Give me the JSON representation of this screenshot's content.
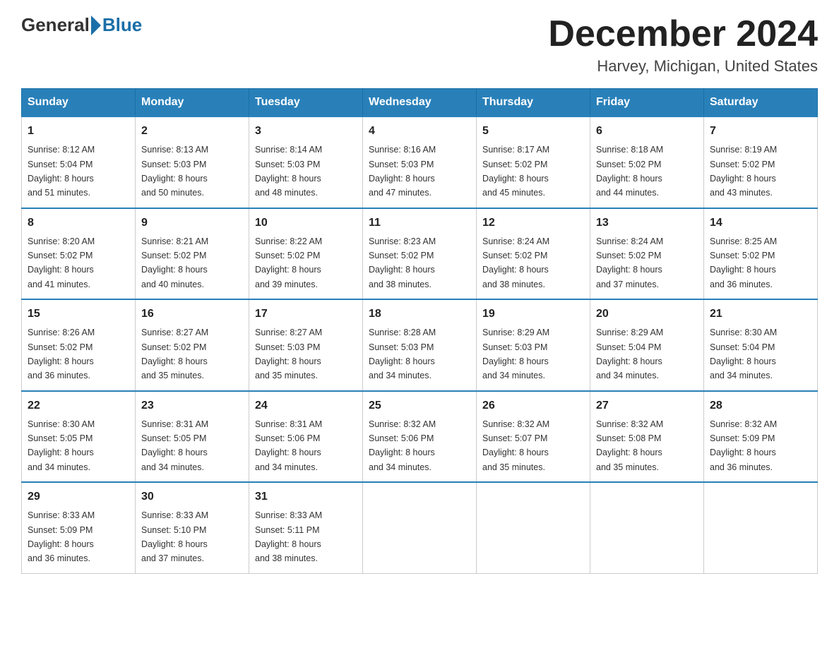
{
  "header": {
    "logo_general": "General",
    "logo_blue": "Blue",
    "title": "December 2024",
    "subtitle": "Harvey, Michigan, United States"
  },
  "days_of_week": [
    "Sunday",
    "Monday",
    "Tuesday",
    "Wednesday",
    "Thursday",
    "Friday",
    "Saturday"
  ],
  "weeks": [
    [
      {
        "day": "1",
        "sunrise": "8:12 AM",
        "sunset": "5:04 PM",
        "daylight": "8 hours and 51 minutes."
      },
      {
        "day": "2",
        "sunrise": "8:13 AM",
        "sunset": "5:03 PM",
        "daylight": "8 hours and 50 minutes."
      },
      {
        "day": "3",
        "sunrise": "8:14 AM",
        "sunset": "5:03 PM",
        "daylight": "8 hours and 48 minutes."
      },
      {
        "day": "4",
        "sunrise": "8:16 AM",
        "sunset": "5:03 PM",
        "daylight": "8 hours and 47 minutes."
      },
      {
        "day": "5",
        "sunrise": "8:17 AM",
        "sunset": "5:02 PM",
        "daylight": "8 hours and 45 minutes."
      },
      {
        "day": "6",
        "sunrise": "8:18 AM",
        "sunset": "5:02 PM",
        "daylight": "8 hours and 44 minutes."
      },
      {
        "day": "7",
        "sunrise": "8:19 AM",
        "sunset": "5:02 PM",
        "daylight": "8 hours and 43 minutes."
      }
    ],
    [
      {
        "day": "8",
        "sunrise": "8:20 AM",
        "sunset": "5:02 PM",
        "daylight": "8 hours and 41 minutes."
      },
      {
        "day": "9",
        "sunrise": "8:21 AM",
        "sunset": "5:02 PM",
        "daylight": "8 hours and 40 minutes."
      },
      {
        "day": "10",
        "sunrise": "8:22 AM",
        "sunset": "5:02 PM",
        "daylight": "8 hours and 39 minutes."
      },
      {
        "day": "11",
        "sunrise": "8:23 AM",
        "sunset": "5:02 PM",
        "daylight": "8 hours and 38 minutes."
      },
      {
        "day": "12",
        "sunrise": "8:24 AM",
        "sunset": "5:02 PM",
        "daylight": "8 hours and 38 minutes."
      },
      {
        "day": "13",
        "sunrise": "8:24 AM",
        "sunset": "5:02 PM",
        "daylight": "8 hours and 37 minutes."
      },
      {
        "day": "14",
        "sunrise": "8:25 AM",
        "sunset": "5:02 PM",
        "daylight": "8 hours and 36 minutes."
      }
    ],
    [
      {
        "day": "15",
        "sunrise": "8:26 AM",
        "sunset": "5:02 PM",
        "daylight": "8 hours and 36 minutes."
      },
      {
        "day": "16",
        "sunrise": "8:27 AM",
        "sunset": "5:02 PM",
        "daylight": "8 hours and 35 minutes."
      },
      {
        "day": "17",
        "sunrise": "8:27 AM",
        "sunset": "5:03 PM",
        "daylight": "8 hours and 35 minutes."
      },
      {
        "day": "18",
        "sunrise": "8:28 AM",
        "sunset": "5:03 PM",
        "daylight": "8 hours and 34 minutes."
      },
      {
        "day": "19",
        "sunrise": "8:29 AM",
        "sunset": "5:03 PM",
        "daylight": "8 hours and 34 minutes."
      },
      {
        "day": "20",
        "sunrise": "8:29 AM",
        "sunset": "5:04 PM",
        "daylight": "8 hours and 34 minutes."
      },
      {
        "day": "21",
        "sunrise": "8:30 AM",
        "sunset": "5:04 PM",
        "daylight": "8 hours and 34 minutes."
      }
    ],
    [
      {
        "day": "22",
        "sunrise": "8:30 AM",
        "sunset": "5:05 PM",
        "daylight": "8 hours and 34 minutes."
      },
      {
        "day": "23",
        "sunrise": "8:31 AM",
        "sunset": "5:05 PM",
        "daylight": "8 hours and 34 minutes."
      },
      {
        "day": "24",
        "sunrise": "8:31 AM",
        "sunset": "5:06 PM",
        "daylight": "8 hours and 34 minutes."
      },
      {
        "day": "25",
        "sunrise": "8:32 AM",
        "sunset": "5:06 PM",
        "daylight": "8 hours and 34 minutes."
      },
      {
        "day": "26",
        "sunrise": "8:32 AM",
        "sunset": "5:07 PM",
        "daylight": "8 hours and 35 minutes."
      },
      {
        "day": "27",
        "sunrise": "8:32 AM",
        "sunset": "5:08 PM",
        "daylight": "8 hours and 35 minutes."
      },
      {
        "day": "28",
        "sunrise": "8:32 AM",
        "sunset": "5:09 PM",
        "daylight": "8 hours and 36 minutes."
      }
    ],
    [
      {
        "day": "29",
        "sunrise": "8:33 AM",
        "sunset": "5:09 PM",
        "daylight": "8 hours and 36 minutes."
      },
      {
        "day": "30",
        "sunrise": "8:33 AM",
        "sunset": "5:10 PM",
        "daylight": "8 hours and 37 minutes."
      },
      {
        "day": "31",
        "sunrise": "8:33 AM",
        "sunset": "5:11 PM",
        "daylight": "8 hours and 38 minutes."
      },
      null,
      null,
      null,
      null
    ]
  ],
  "labels": {
    "sunrise": "Sunrise:",
    "sunset": "Sunset:",
    "daylight": "Daylight:"
  }
}
